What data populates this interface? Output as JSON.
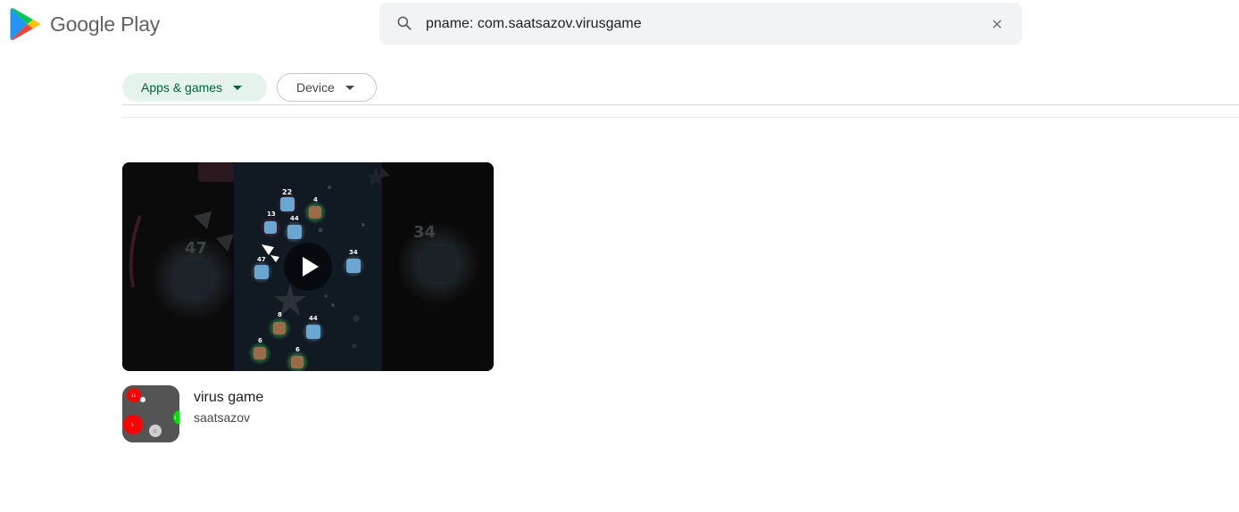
{
  "header": {
    "brand": "Google Play",
    "logo_icon": "google-play-triangle-icon",
    "search": {
      "value": "pname: com.saatsazov.virusgame",
      "icon": "search-icon",
      "clear_icon": "close-icon"
    }
  },
  "filters": {
    "chips": [
      {
        "label": "Apps & games",
        "selected": true
      },
      {
        "label": "Device",
        "selected": false
      }
    ]
  },
  "results": [
    {
      "title": "virus game",
      "developer": "saatsazov",
      "video": {
        "play_icon": "play-icon",
        "scene_numbers": [
          "22",
          "4",
          "13",
          "44",
          "47",
          "34",
          "47",
          "34",
          "8",
          "44",
          "6",
          "6"
        ]
      },
      "icon_numbers": [
        "13",
        "3",
        "11",
        "2"
      ]
    }
  ],
  "colors": {
    "chip_selected_bg": "#e6f3ec",
    "chip_selected_text": "#01623a",
    "search_bg": "#f1f3f4"
  }
}
